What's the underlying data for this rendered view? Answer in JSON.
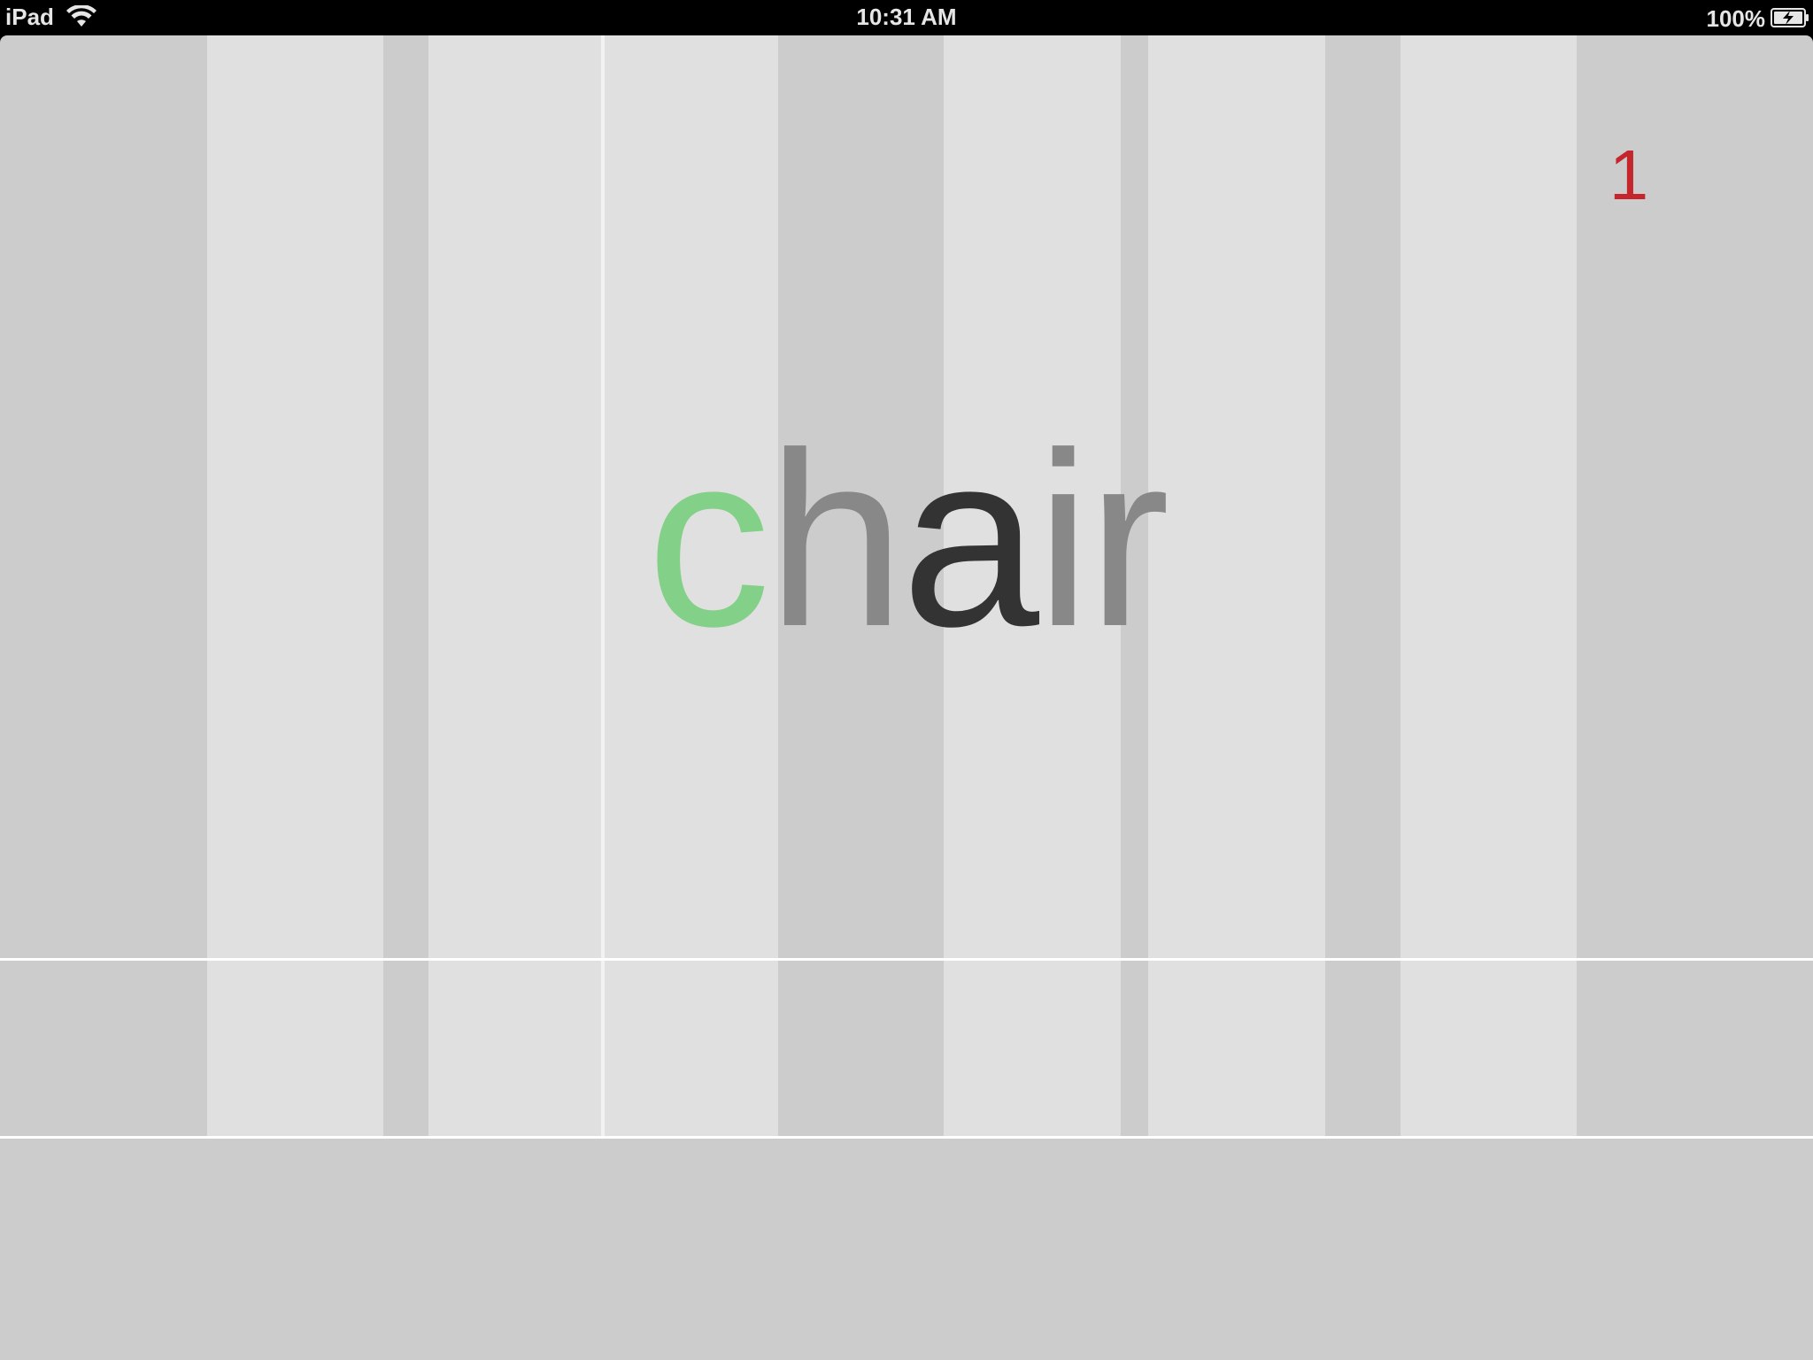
{
  "status_bar": {
    "device": "iPad",
    "time": "10:31 AM",
    "battery": "100%"
  },
  "game": {
    "counter": "1",
    "word": {
      "letters": [
        {
          "char": "c",
          "color": "#83d088"
        },
        {
          "char": "h",
          "color": "#888888"
        },
        {
          "char": "a",
          "color": "#333333"
        },
        {
          "char": "i",
          "color": "#888888"
        },
        {
          "char": "r",
          "color": "#888888"
        }
      ]
    }
  },
  "colors": {
    "background": "#cccccc",
    "lane": "#e0e0e0",
    "counter": "#c4262b",
    "status_bar": "#000000"
  }
}
